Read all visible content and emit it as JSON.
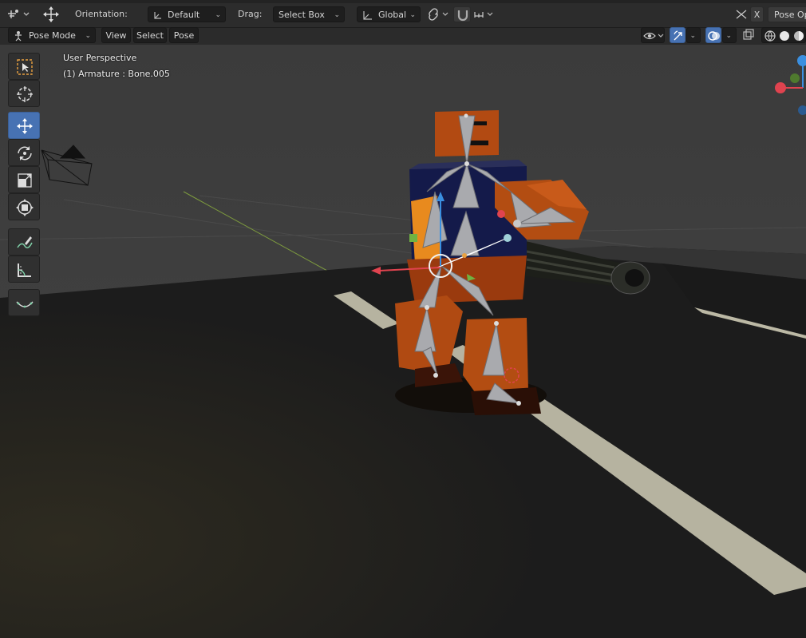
{
  "header": {
    "orientation_label": "Orientation:",
    "orientation_value": "Default",
    "drag_label": "Drag:",
    "drag_value": "Select Box",
    "transform_value": "Global",
    "x_label": "X",
    "pose_options_label": "Pose Op"
  },
  "viewport_header": {
    "mode": "Pose Mode",
    "menus": [
      "View",
      "Select",
      "Pose"
    ]
  },
  "viewport": {
    "perspective_label": "User Perspective",
    "active_object_label": "(1) Armature : Bone.005"
  },
  "toolbar": {
    "tools": [
      {
        "icon": "select-box-icon"
      },
      {
        "icon": "cursor-icon"
      },
      {
        "icon": "move-icon",
        "active": true
      },
      {
        "icon": "rotate-icon"
      },
      {
        "icon": "scale-icon"
      },
      {
        "icon": "transform-icon"
      },
      {
        "icon": "annotate-icon"
      },
      {
        "icon": "measure-icon"
      },
      {
        "icon": "relax-icon"
      }
    ]
  },
  "colors": {
    "accent": "#4772b3",
    "floor": "#1f1f1f",
    "road_stripe": "#b6b3a0",
    "robot_orange": "#b34d12",
    "bone_gray": "#a9aaae",
    "selected_bone": "#7fb2c0",
    "x_axis": "#e0434f",
    "y_axis": "#7aa93c",
    "z_axis": "#3a8fe0"
  }
}
